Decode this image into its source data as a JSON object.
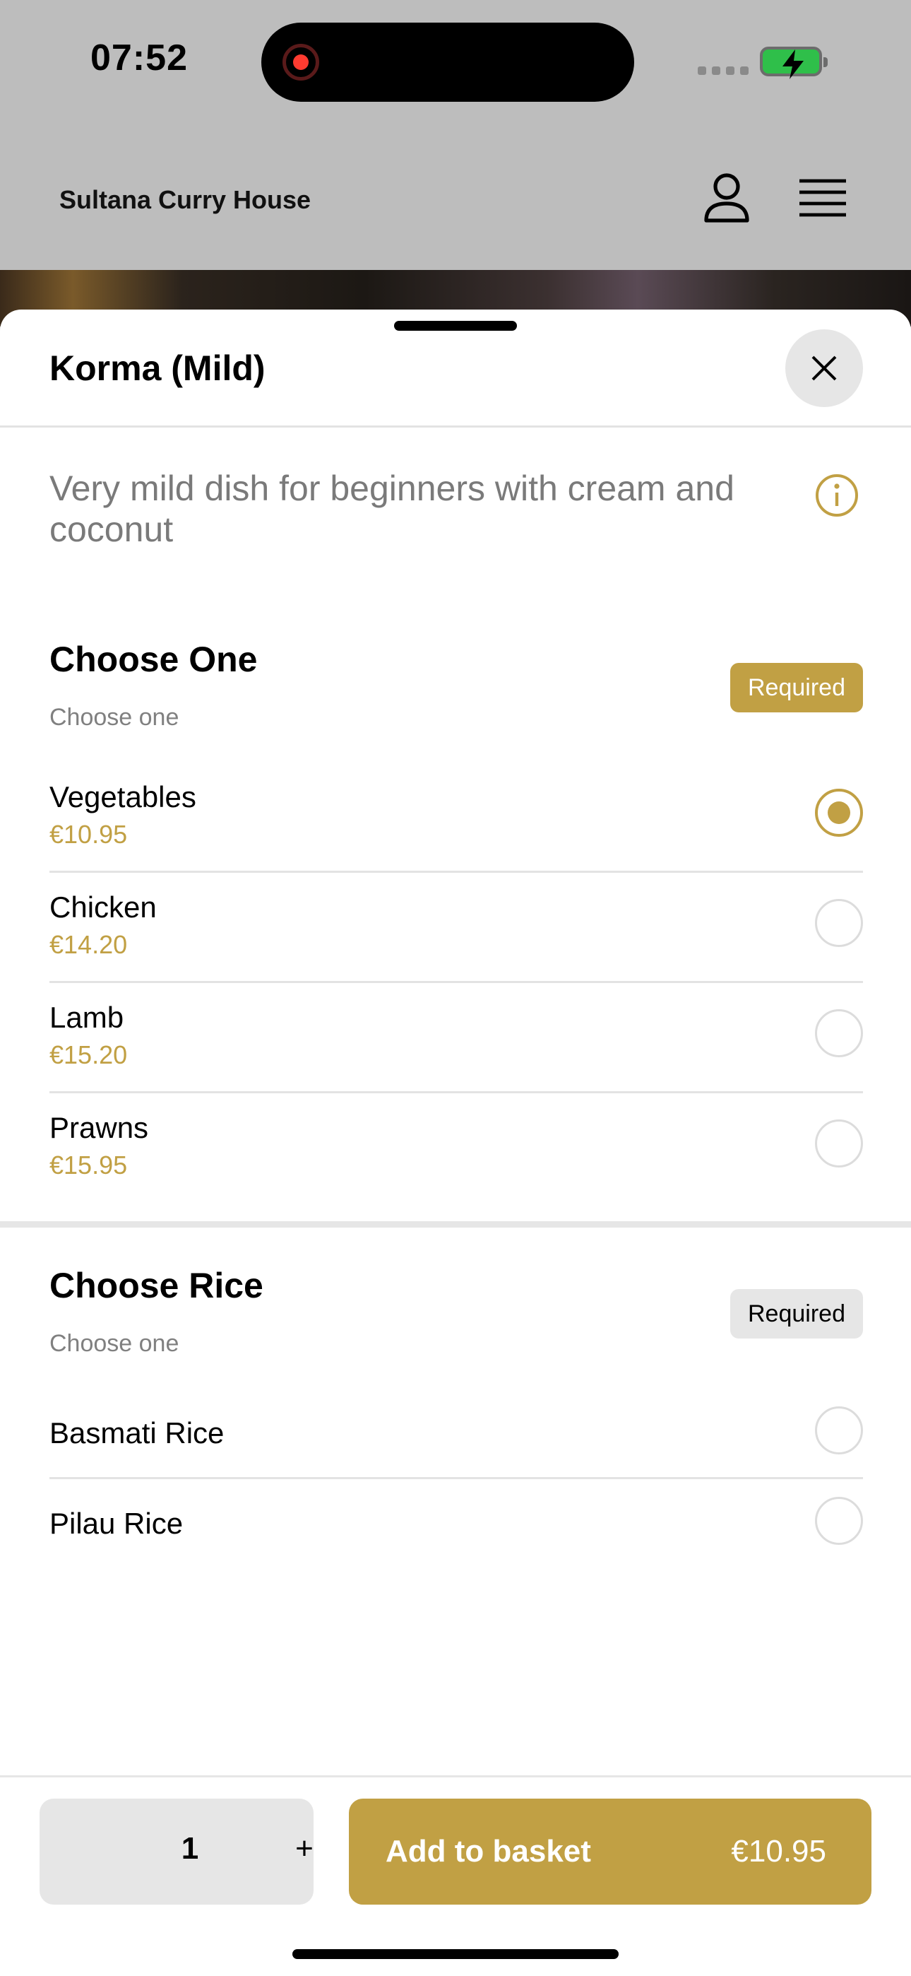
{
  "status_bar": {
    "time": "07:52"
  },
  "header": {
    "app_title": "Sultana Curry House",
    "icons": [
      "user-icon",
      "menu-icon"
    ]
  },
  "sheet": {
    "title": "Korma (Mild)",
    "description": "Very mild dish for beginners with cream and coconut",
    "sections": [
      {
        "title": "Choose One",
        "subtitle": "Choose one",
        "badge": "Required",
        "badge_style": "gold",
        "options": [
          {
            "name": "Vegetables",
            "price": "€10.95",
            "selected": true
          },
          {
            "name": "Chicken",
            "price": "€14.20",
            "selected": false
          },
          {
            "name": "Lamb",
            "price": "€15.20",
            "selected": false
          },
          {
            "name": "Prawns",
            "price": "€15.95",
            "selected": false
          }
        ]
      },
      {
        "title": "Choose Rice",
        "subtitle": "Choose one",
        "badge": "Required",
        "badge_style": "grey",
        "options": [
          {
            "name": "Basmati Rice",
            "selected": false
          },
          {
            "name": "Pilau Rice",
            "selected": false
          }
        ]
      }
    ]
  },
  "footer": {
    "quantity": "1",
    "plus": "+",
    "add_label": "Add to basket",
    "add_price": "€10.95"
  },
  "colors": {
    "accent": "#c1a044",
    "badge_grey": "#e6e6e6"
  }
}
